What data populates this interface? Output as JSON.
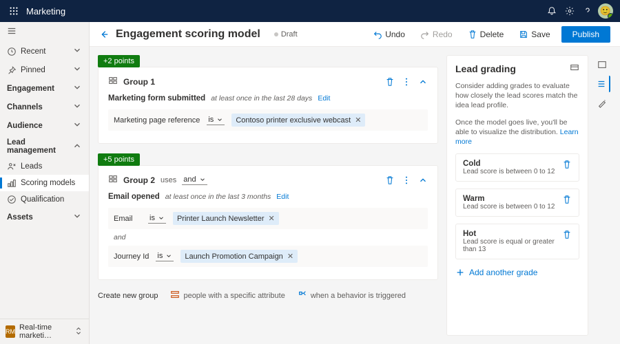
{
  "topbar": {
    "app_name": "Marketing"
  },
  "sidebar": {
    "recent": "Recent",
    "pinned": "Pinned",
    "sections": {
      "engagement": "Engagement",
      "channels": "Channels",
      "audience": "Audience",
      "lead_mgmt": "Lead management",
      "assets": "Assets"
    },
    "lead_items": {
      "leads": "Leads",
      "scoring": "Scoring models",
      "qualification": "Qualification"
    },
    "footer": {
      "badge": "RM",
      "label": "Real-time marketi…"
    }
  },
  "cmdbar": {
    "title": "Engagement scoring model",
    "status": "Draft",
    "undo": "Undo",
    "redo": "Redo",
    "delete": "Delete",
    "save": "Save",
    "publish": "Publish"
  },
  "groups": [
    {
      "points": "+2 points",
      "name": "Group 1",
      "uses": null,
      "conditions": [
        {
          "label": "Marketing form submitted",
          "meta": "at least once in the last 28 days",
          "edit": "Edit",
          "rows": [
            {
              "field": "Marketing page reference",
              "op": "is",
              "value": "Contoso printer exclusive webcast"
            }
          ]
        }
      ]
    },
    {
      "points": "+5 points",
      "name": "Group 2",
      "uses": "uses",
      "uses_op": "and",
      "conditions": [
        {
          "label": "Email opened",
          "meta": "at least once in the last 3 months",
          "edit": "Edit",
          "rows": [
            {
              "field": "Email",
              "op": "is",
              "value": "Printer Launch Newsletter"
            },
            {
              "and": "and"
            },
            {
              "field": "Journey Id",
              "op": "is",
              "value": "Launch Promotion Campaign"
            }
          ]
        }
      ]
    }
  ],
  "new_group": {
    "header": "Create new group",
    "attr": "people with a specific attribute",
    "behavior": "when a behavior is triggered"
  },
  "lead_panel": {
    "title": "Lead grading",
    "p1": "Consider adding grades to evaluate how closely the lead scores match the idea lead profile.",
    "p2a": "Once the model goes live, you'll be able to visualize the distribution. ",
    "learn": "Learn more",
    "grades": [
      {
        "name": "Cold",
        "sub": "Lead score is between 0 to 12"
      },
      {
        "name": "Warm",
        "sub": "Lead score is between 0 to 12"
      },
      {
        "name": "Hot",
        "sub": "Lead score is equal or greater than 13"
      }
    ],
    "add": "Add another grade"
  }
}
